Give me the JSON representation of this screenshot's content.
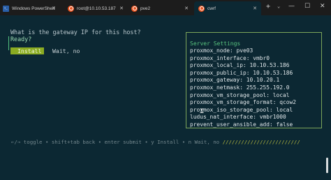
{
  "tabs": [
    {
      "label": "Windows PowerShell",
      "icon": "powershell-icon"
    },
    {
      "label": "root@10.10.53.187",
      "icon": "ubuntu-icon"
    },
    {
      "label": "pve2",
      "icon": "ubuntu-icon"
    },
    {
      "label": "cwrf",
      "icon": "ubuntu-icon"
    }
  ],
  "tab_bar": {
    "new_tab": "+",
    "dropdown": "⌄",
    "minimize": "—",
    "maximize": "☐",
    "close": "✕",
    "tab_close": "✕"
  },
  "prompt": {
    "question": "What is the gateway IP for this host?",
    "status": "Ready?",
    "buttons": {
      "install": "Install",
      "wait": "Wait, no"
    }
  },
  "settings": {
    "title": "Server Settings",
    "rows": [
      "proxmox_node: pve03",
      "proxmox_interface: vmbr0",
      "proxmox_local_ip: 10.10.53.186",
      "proxmox_public_ip: 10.10.53.186",
      "proxmox_gateway: 10.10.20.1",
      "proxmox_netmask: 255.255.192.0",
      "proxmox_vm_storage_pool: local",
      "proxmox_vm_storage_format: qcow2",
      "proxmox_iso_storage_pool: local",
      "ludus_nat_interface: vmbr1000",
      "prevent_user_ansible_add: false"
    ]
  },
  "help": {
    "text": "←/→ toggle • shift+tab back • enter submit • y Install • n Wait, no ",
    "slashes": "/////////////////////////"
  },
  "colors": {
    "background": "#0c2833",
    "accent_green": "#58c27e",
    "button_bg": "#8bab22",
    "border": "#7da65b"
  }
}
